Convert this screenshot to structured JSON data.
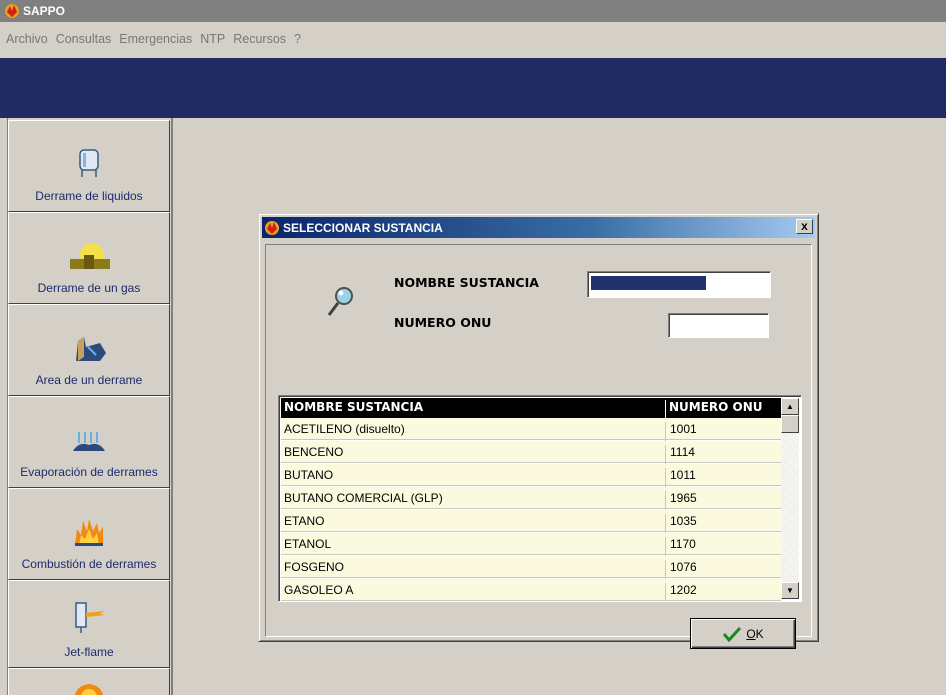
{
  "window": {
    "title": "SAPPO"
  },
  "menu": [
    "Archivo",
    "Consultas",
    "Emergencias",
    "NTP",
    "Recursos",
    "?"
  ],
  "sidebar": {
    "items": [
      {
        "label": "Derrame de liquidos",
        "icon": "tank-icon"
      },
      {
        "label": "Derrame de un gas",
        "icon": "gas-cloud-icon"
      },
      {
        "label": "Area de un derrame",
        "icon": "spill-area-icon"
      },
      {
        "label": "Evaporación de derrames",
        "icon": "evaporation-icon"
      },
      {
        "label": "Combustión de derrames",
        "icon": "fire-icon"
      },
      {
        "label": "Jet-flame",
        "icon": "jet-flame-icon"
      }
    ]
  },
  "dialog": {
    "title": "SELECCIONAR SUSTANCIA",
    "close": "x",
    "name_label": "NOMBRE SUSTANCIA",
    "onu_label": "NUMERO  ONU",
    "name_value": "",
    "onu_value": "",
    "grid": {
      "headers": [
        "NOMBRE SUSTANCIA",
        "NUMERO ONU"
      ],
      "rows": [
        [
          "ACETILENO (disuelto)",
          "1001"
        ],
        [
          "BENCENO",
          "1114"
        ],
        [
          "BUTANO",
          "1011"
        ],
        [
          "BUTANO COMERCIAL (GLP)",
          "1965"
        ],
        [
          "ETANO",
          "1035"
        ],
        [
          "ETANOL",
          "1170"
        ],
        [
          "FOSGENO",
          "1076"
        ],
        [
          "GASOLEO A",
          "1202"
        ]
      ]
    },
    "ok_label": "OK",
    "ok_underline": "O",
    "ok_rest": "K"
  },
  "colors": {
    "bluebar": "#212a63",
    "title_gradient_start": "#0a246a",
    "grid_row_bg": "#fbfadf"
  }
}
